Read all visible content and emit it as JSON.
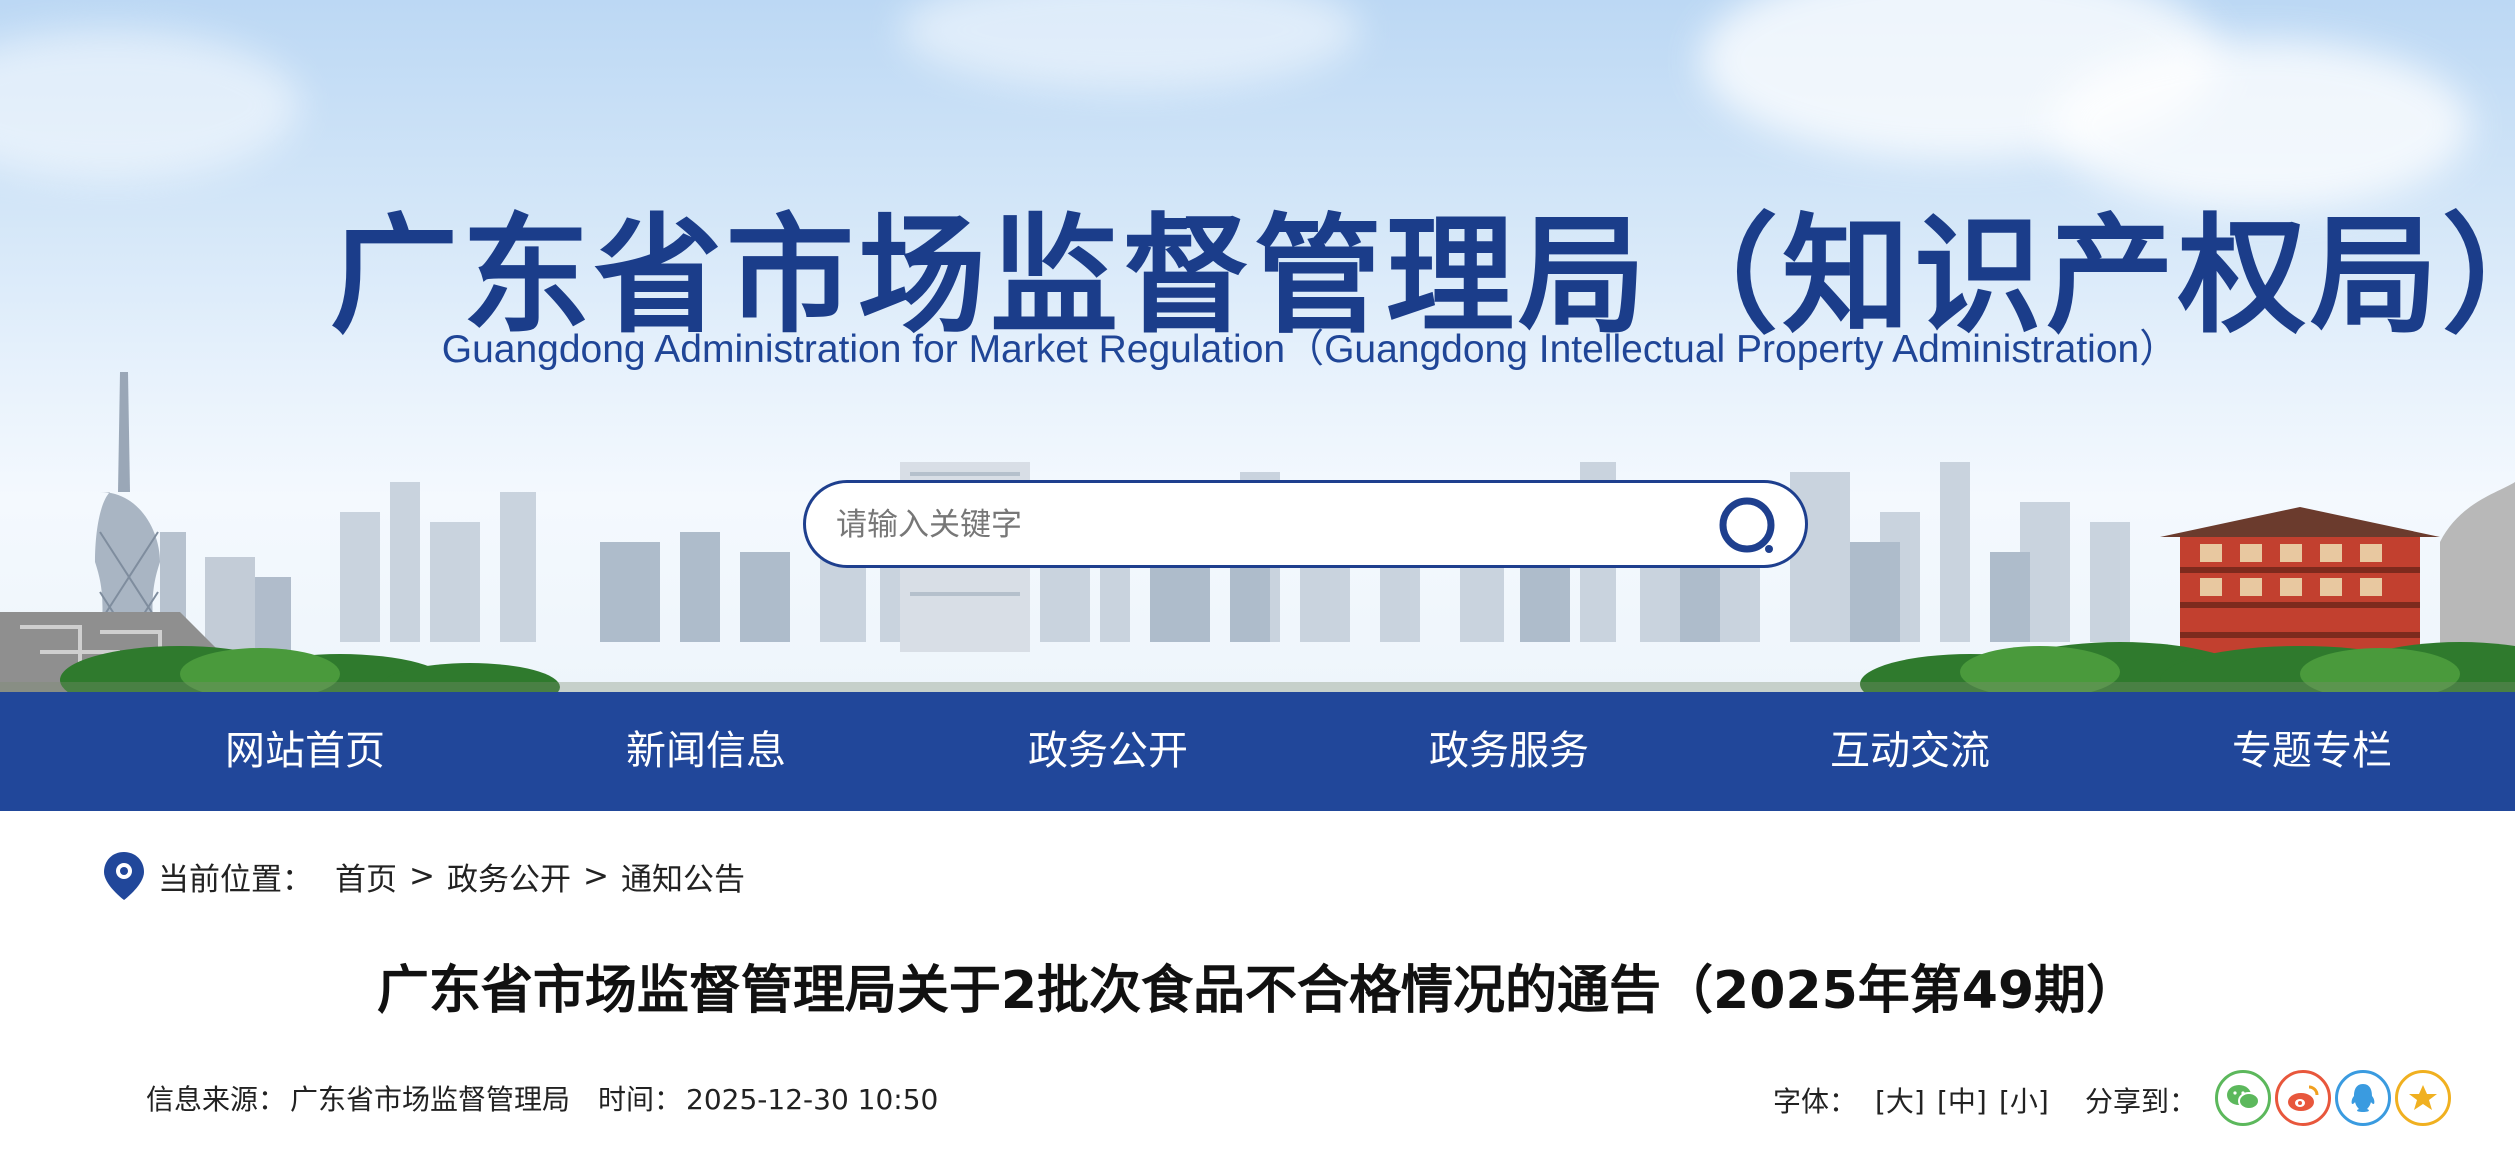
{
  "header": {
    "title_cn": "广东省市场监督管理局（知识产权局）",
    "title_en": "Guangdong Administration for Market Regulation（Guangdong Intellectual Property Administration）"
  },
  "search": {
    "placeholder": "请输入关键字"
  },
  "nav": {
    "items": [
      "网站首页",
      "新闻信息",
      "政务公开",
      "政务服务",
      "互动交流",
      "专题专栏"
    ]
  },
  "breadcrumb": {
    "label": "当前位置：",
    "items": [
      "首页",
      "政务公开",
      "通知公告"
    ],
    "separator": ">"
  },
  "article": {
    "title": "广东省市场监督管理局关于2批次食品不合格情况的通告（2025年第49期）",
    "source_label": "信息来源：",
    "source": "广东省市场监督管理局",
    "time_label": "时间：",
    "time": "2025-12-30 10:50"
  },
  "tools": {
    "font_label": "字体：",
    "font_large": "[大]",
    "font_medium": "[中]",
    "font_small": "[小]",
    "share_label": "分享到：",
    "share_icons": [
      {
        "name": "wechat-icon",
        "color": "#5cb85c"
      },
      {
        "name": "weibo-icon",
        "color": "#e8573c"
      },
      {
        "name": "qq-icon",
        "color": "#3a9be0"
      },
      {
        "name": "qzone-icon",
        "color": "#f0b020"
      }
    ]
  },
  "colors": {
    "nav_bg": "#21479a",
    "title_blue": "#1b3d8a"
  }
}
